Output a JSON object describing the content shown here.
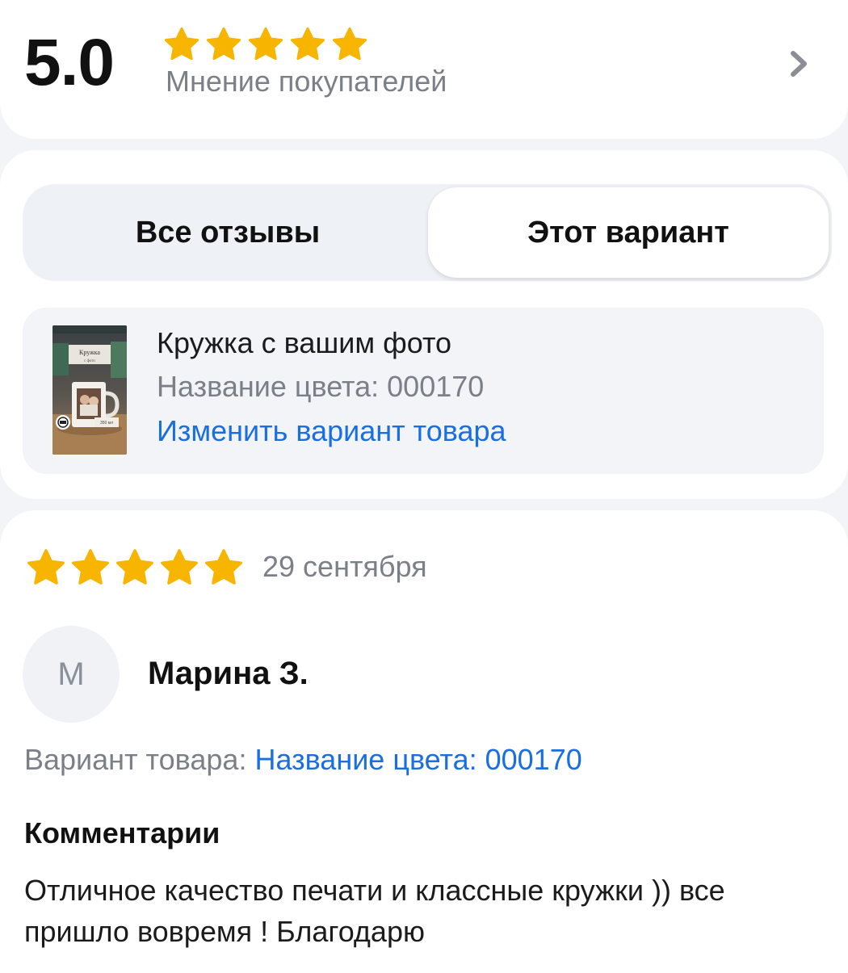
{
  "summary": {
    "rating": "5.0",
    "stars": 5,
    "subtitle": "Мнение покупателей",
    "chevron_icon": "chevron-right-icon"
  },
  "tabs": {
    "all_label": "Все отзывы",
    "this_label": "Этот вариант",
    "selected": "this"
  },
  "product": {
    "title": "Кружка с вашим фото",
    "color": "Название цвета: 000170",
    "change_link": "Изменить вариант товара",
    "thumbnail": {
      "caption": "Кружка",
      "small_caption": "с фото",
      "volume": "350 мл"
    }
  },
  "review": {
    "stars": 5,
    "date": "29 сентября",
    "avatar_letter": "M",
    "author": "Марина З.",
    "variant_label": "Вариант товара: ",
    "variant_value": "Название цвета: 000170",
    "comments_title": "Комментарии",
    "comment": "Отличное качество печати и классные кружки )) все пришло вовремя ! Благодарю"
  },
  "colors": {
    "star": "#f7b500",
    "link": "#1a6fe0",
    "muted_text": "#7b8088",
    "background": "#f2f4f7"
  }
}
